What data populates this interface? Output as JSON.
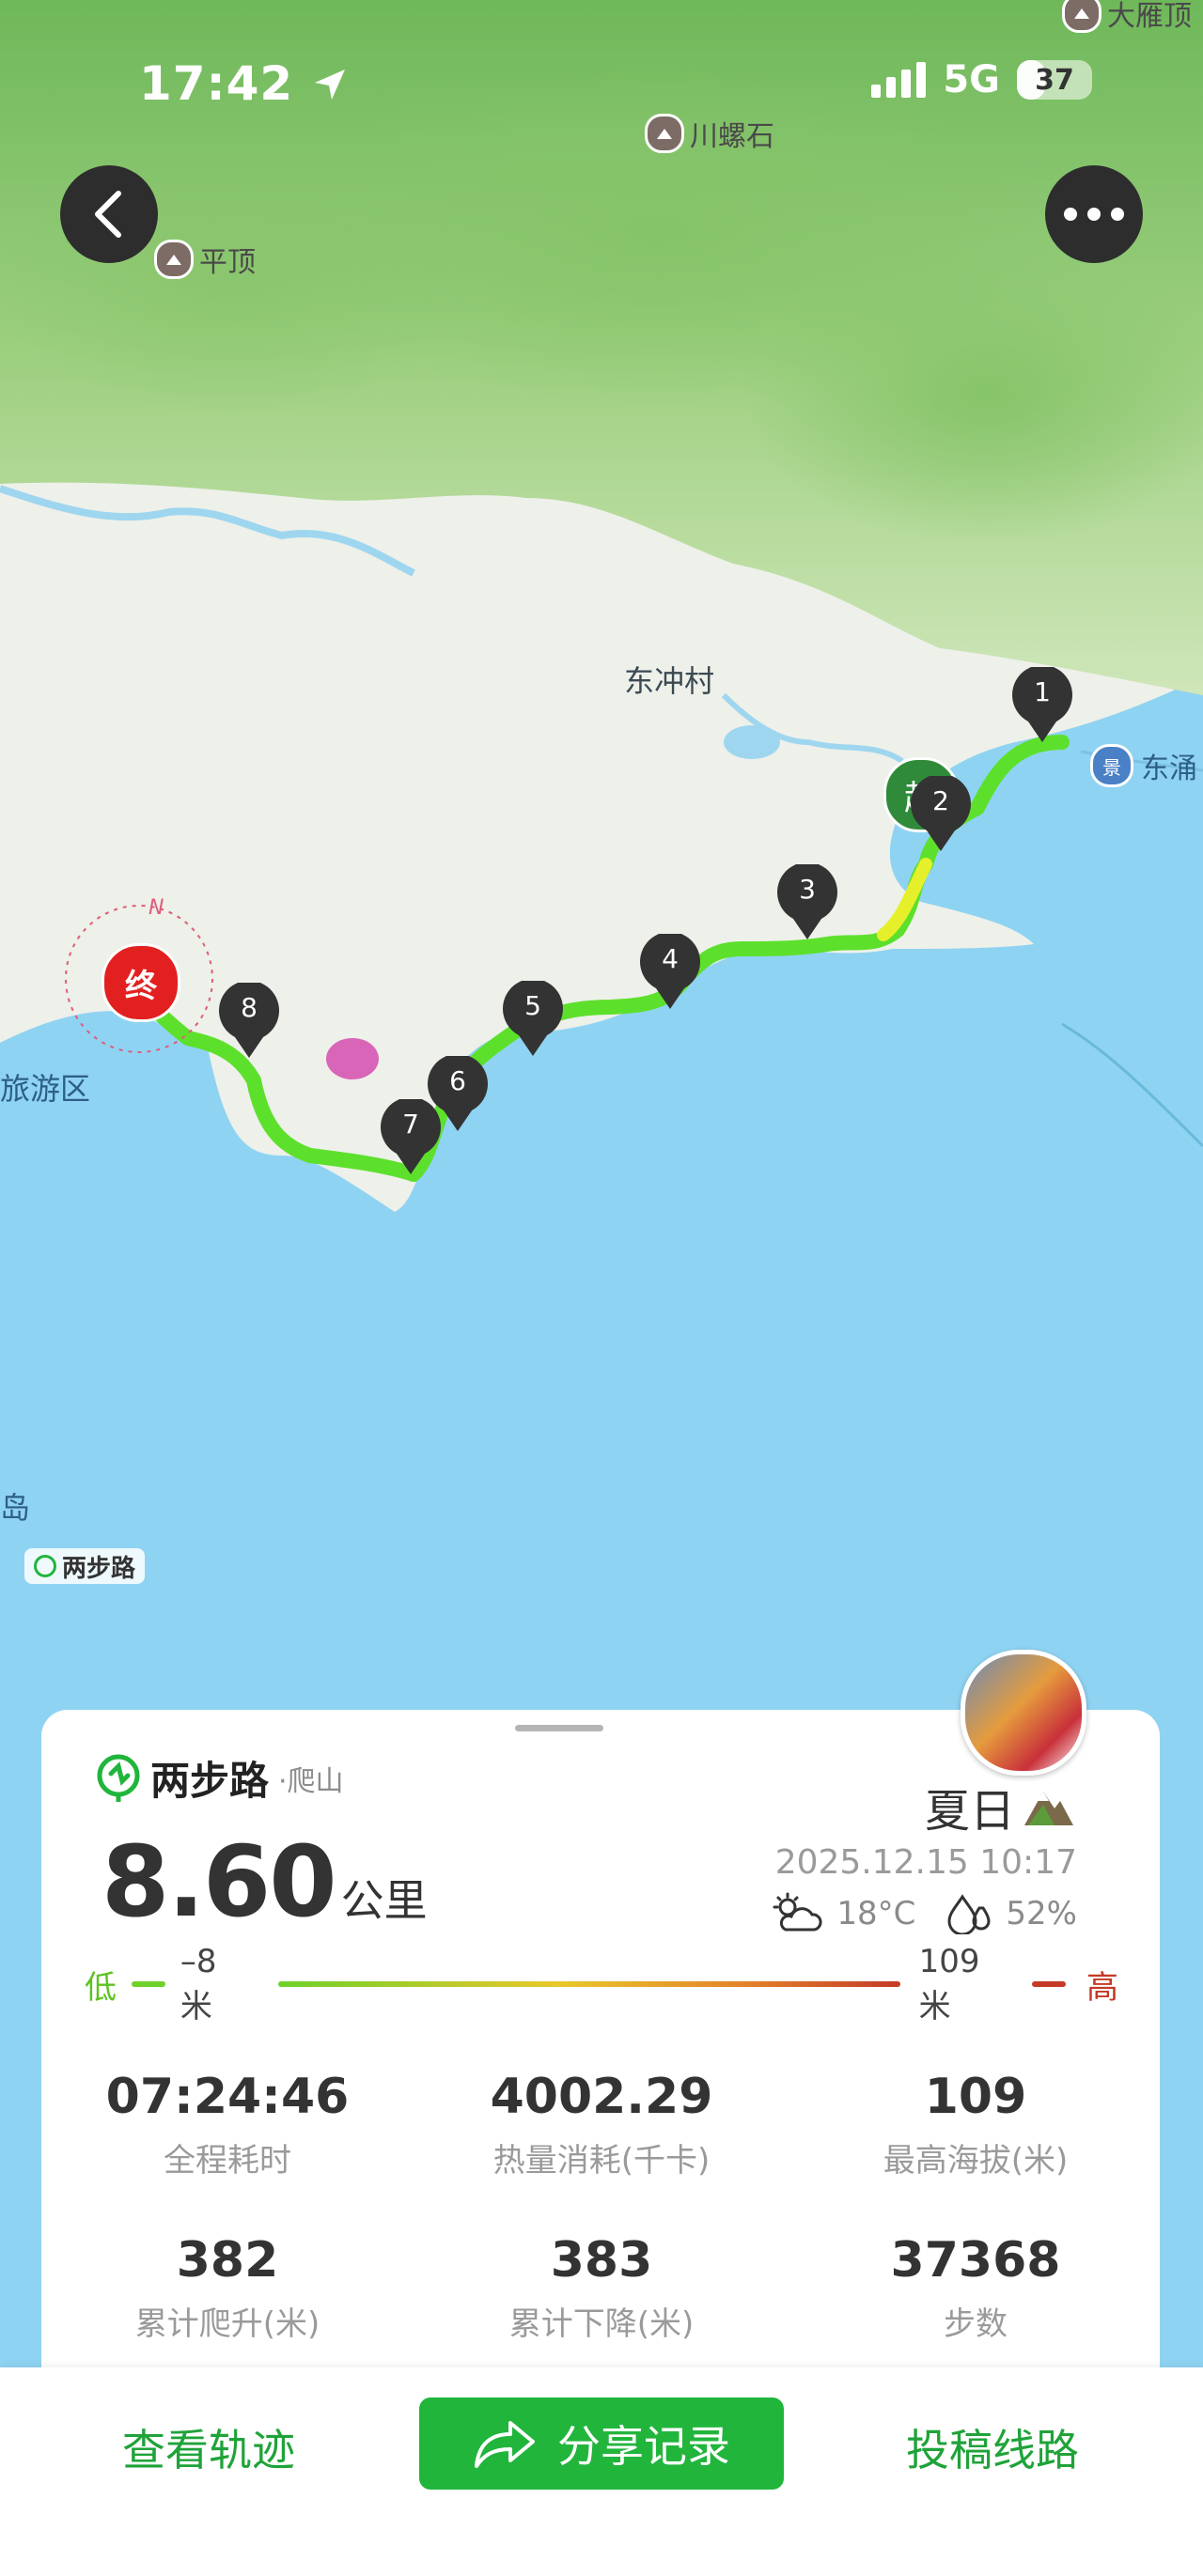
{
  "status_bar": {
    "time": "17:42",
    "network": "5G",
    "battery": "37",
    "battery_level": 0.37
  },
  "map": {
    "pois": [
      {
        "id": "chuanluoshi",
        "label": "川螺石"
      },
      {
        "id": "pingding",
        "label": "平顶"
      },
      {
        "id": "dayanding",
        "label": "大雁顶"
      }
    ],
    "places": {
      "dongchong": "东冲村",
      "dongyong": "东涌",
      "tourism": "旅游区",
      "island": "岛"
    },
    "markers": [
      "1",
      "2",
      "3",
      "4",
      "5",
      "6",
      "7",
      "8"
    ],
    "start_label": "起",
    "end_label": "终",
    "compass": "N",
    "watermark": "两步路"
  },
  "card": {
    "brand": "两步路",
    "activity": "·爬山",
    "distance": "8.60",
    "distance_unit": "公里",
    "username": "夏日",
    "datetime": "2025.12.15 10:17",
    "temperature": "18°C",
    "humidity": "52%",
    "elevation": {
      "low_label": "低",
      "low_value": "–8米",
      "high_value": "109米",
      "high_label": "高",
      "low_color": "#6fd02a",
      "high_color": "#c43a27"
    },
    "stats": [
      {
        "value": "07:24:46",
        "label": "全程耗时"
      },
      {
        "value": "4002.29",
        "label": "热量消耗(千卡)"
      },
      {
        "value": "109",
        "label": "最高海拔(米)"
      },
      {
        "value": "382",
        "label": "累计爬升(米)"
      },
      {
        "value": "383",
        "label": "累计下降(米)"
      },
      {
        "value": "37368",
        "label": "步数"
      }
    ]
  },
  "actions": {
    "view_track": "查看轨迹",
    "share": "分享记录",
    "submit_route": "投稿线路"
  },
  "colors": {
    "accent": "#21b53c",
    "route": "#5de02c",
    "water": "#8fd3f2",
    "end": "#e32020",
    "start": "#2f8a3a"
  },
  "icons": [
    "back-arrow-icon",
    "more-icon",
    "location-arrow-icon",
    "mountain-icon",
    "share-icon",
    "weather-icon",
    "humidity-icon"
  ]
}
